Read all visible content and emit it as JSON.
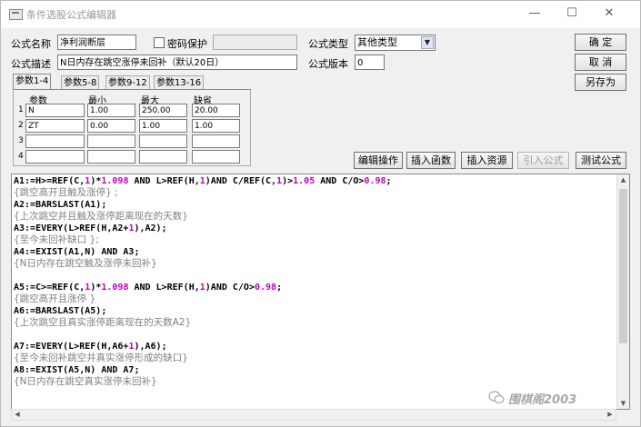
{
  "window": {
    "title": "条件选股公式编辑器",
    "minimize": "—",
    "maximize": "☐",
    "close": "✕"
  },
  "form": {
    "name_label": "公式名称",
    "name_value": "净利润断层",
    "password_label": "密码保护",
    "desc_label": "公式描述",
    "desc_value": "N日内存在跳空涨停未回补（默认20日）",
    "type_label": "公式类型",
    "type_value": "其他类型",
    "version_label": "公式版本",
    "version_value": "0"
  },
  "tabs": [
    "参数1-4",
    "参数5-8",
    "参数9-12",
    "参数13-16"
  ],
  "params": {
    "headers": {
      "name": "参数",
      "min": "最小",
      "max": "最大",
      "default": "缺省"
    },
    "rows": [
      {
        "num": "1",
        "name": "N",
        "min": "1.00",
        "max": "250.00",
        "default": "20.00"
      },
      {
        "num": "2",
        "name": "ZT",
        "min": "0.00",
        "max": "1.00",
        "default": "1.00"
      },
      {
        "num": "3",
        "name": "",
        "min": "",
        "max": "",
        "default": ""
      },
      {
        "num": "4",
        "name": "",
        "min": "",
        "max": "",
        "default": ""
      }
    ]
  },
  "buttons": {
    "confirm": "确  定",
    "cancel": "取  消",
    "save_as": "另存为",
    "edit_ops": "编辑操作",
    "insert_func": "插入函数",
    "insert_res": "插入资源",
    "import_formula": "引入公式",
    "test_formula": "测试公式"
  },
  "code_lines": [
    [
      [
        "kw",
        "A1:=H>=REF(C,"
      ],
      [
        "num",
        "1"
      ],
      [
        "kw",
        ")*"
      ],
      [
        "num",
        "1.098"
      ],
      [
        "kw",
        " AND L>REF(H,"
      ],
      [
        "num",
        "1"
      ],
      [
        "kw",
        ")AND C/REF(C,"
      ],
      [
        "num",
        "1"
      ],
      [
        "kw",
        ")>"
      ],
      [
        "num",
        "1.05"
      ],
      [
        "kw",
        " AND C/O>"
      ],
      [
        "num",
        "0.98"
      ],
      [
        "kw",
        ";"
      ]
    ],
    [
      [
        "cmt",
        "{跳空高开且触及涨停} ;"
      ]
    ],
    [
      [
        "kw",
        "A2:=BARSLAST(A1);"
      ]
    ],
    [
      [
        "cmt",
        "{上次跳空并且触及涨停距离现在的天数}"
      ]
    ],
    [
      [
        "kw",
        "A3:=EVERY(L>REF(H,A2+"
      ],
      [
        "num",
        "1"
      ],
      [
        "kw",
        "),A2);"
      ]
    ],
    [
      [
        "cmt",
        "{至今未回补缺口 };"
      ]
    ],
    [
      [
        "kw",
        "A4:=EXIST(A1,N) AND A3;"
      ]
    ],
    [
      [
        "cmt",
        "{N日内存在跳空触及涨停未回补}"
      ]
    ],
    [],
    [
      [
        "kw",
        "A5:=C>=REF(C,"
      ],
      [
        "num",
        "1"
      ],
      [
        "kw",
        ")*"
      ],
      [
        "num",
        "1.098"
      ],
      [
        "kw",
        " AND L>REF(H,"
      ],
      [
        "num",
        "1"
      ],
      [
        "kw",
        ")AND C/O>"
      ],
      [
        "num",
        "0.98"
      ],
      [
        "kw",
        ";"
      ]
    ],
    [
      [
        "cmt",
        "{跳空高开且涨停 }"
      ]
    ],
    [
      [
        "kw",
        "A6:=BARSLAST(A5);"
      ]
    ],
    [
      [
        "cmt",
        "{上次跳空且真实涨停距离现在的天数A2}"
      ]
    ],
    [],
    [
      [
        "kw",
        "A7:=EVERY(L>REF(H,A6+"
      ],
      [
        "num",
        "1"
      ],
      [
        "kw",
        "),A6);"
      ]
    ],
    [
      [
        "cmt",
        "{至今未回补跳空并真实涨停形成的缺口}"
      ]
    ],
    [
      [
        "kw",
        "A8:=EXIST(A5,N) AND A7;"
      ]
    ],
    [
      [
        "cmt",
        "{N日内存在跳空真实涨停未回补}"
      ]
    ]
  ],
  "watermark": "围棋阁2003",
  "icons": {
    "app": "formula-editor-icon",
    "dropdown": "chevron-down-icon",
    "checkbox": "checkbox-icon",
    "watermark": "wechat-icon"
  }
}
